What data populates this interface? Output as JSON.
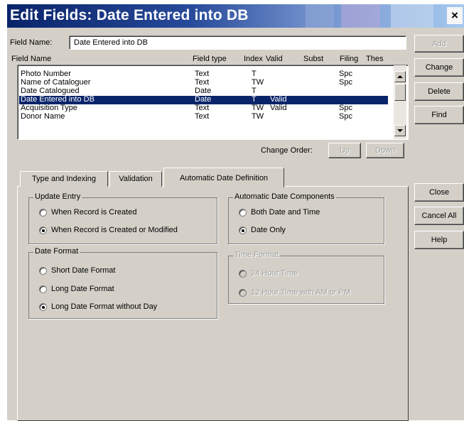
{
  "window": {
    "title": "Edit Fields: Date Entered into DB",
    "close_glyph": "×"
  },
  "field_name": {
    "label": "Field Name:",
    "value": "Date Entered into DB"
  },
  "table": {
    "headers": [
      "Field Name",
      "Field type",
      "Index",
      "Valid",
      "Subst",
      "Filing",
      "Thes"
    ],
    "rows": [
      {
        "name": "Photo Number",
        "type": "Text",
        "index": "T",
        "valid": "",
        "filing": "Spc",
        "selected": false
      },
      {
        "name": "Name of Cataloguer",
        "type": "Text",
        "index": "TW",
        "valid": "",
        "filing": "Spc",
        "selected": false
      },
      {
        "name": "Date Catalogued",
        "type": "Date",
        "index": "T",
        "valid": "",
        "filing": "",
        "selected": false
      },
      {
        "name": "Date Entered into DB",
        "type": "Date",
        "index": "T",
        "valid": "Valid",
        "filing": "",
        "selected": true
      },
      {
        "name": "Acquisition Type",
        "type": "Text",
        "index": "TW",
        "valid": "Valid",
        "filing": "Spc",
        "selected": false
      },
      {
        "name": "Donor Name",
        "type": "Text",
        "index": "TW",
        "valid": "",
        "filing": "Spc",
        "selected": false
      }
    ]
  },
  "change_order": {
    "label": "Change Order:",
    "up": "Up",
    "down": "Down"
  },
  "side_buttons": {
    "add": "Add",
    "change": "Change",
    "delete": "Delete",
    "find": "Find",
    "close": "Close",
    "cancel_all": "Cancel All",
    "help": "Help"
  },
  "tabs": [
    {
      "label": "Type and Indexing",
      "active": false
    },
    {
      "label": "Validation",
      "active": false
    },
    {
      "label": "Automatic Date Definition",
      "active": true
    }
  ],
  "update_entry": {
    "title": "Update Entry",
    "options": [
      {
        "label": "When Record is Created",
        "checked": false
      },
      {
        "label": "When Record is Created or Modified",
        "checked": true
      }
    ]
  },
  "date_format": {
    "title": "Date Format",
    "options": [
      {
        "label": "Short Date Format",
        "checked": false
      },
      {
        "label": "Long Date Format",
        "checked": false
      },
      {
        "label": "Long Date Format without Day",
        "checked": true
      }
    ]
  },
  "date_components": {
    "title": "Automatic Date Components",
    "options": [
      {
        "label": "Both Date and Time",
        "checked": false
      },
      {
        "label": "Date Only",
        "checked": true
      }
    ]
  },
  "time_format": {
    "title": "Time Format",
    "disabled": true,
    "options": [
      {
        "label": "24 Hour Time",
        "checked": false
      },
      {
        "label": "12 Hour Time with AM or PM",
        "checked": false
      }
    ]
  },
  "colors": {
    "selection": "#0a246a",
    "face": "#d4d0c8",
    "title_start": "#0a246a",
    "title_end": "#a6caf0"
  }
}
